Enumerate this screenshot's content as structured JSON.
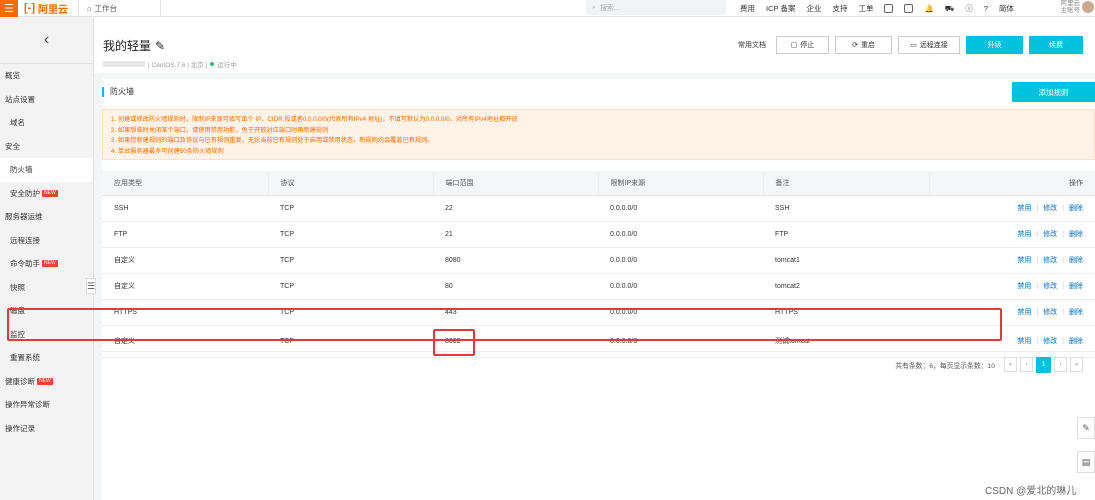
{
  "topbar": {
    "brand": "阿里云",
    "workbench": "工作台",
    "search_placeholder": "搜索...",
    "nav": [
      "费用",
      "ICP 备案",
      "企业",
      "支持",
      "工单",
      "简体"
    ],
    "account_name": "阿里云",
    "account_role": "主账号"
  },
  "sidebar": {
    "items": [
      {
        "label": "概览",
        "sub": false,
        "badge": ""
      },
      {
        "label": "站点设置",
        "sub": false,
        "badge": ""
      },
      {
        "label": "域名",
        "sub": true,
        "badge": ""
      },
      {
        "label": "安全",
        "sub": false,
        "badge": ""
      },
      {
        "label": "防火墙",
        "sub": true,
        "badge": "",
        "active": true
      },
      {
        "label": "安全防护",
        "sub": true,
        "badge": "NEW"
      },
      {
        "label": "服务器运维",
        "sub": false,
        "badge": ""
      },
      {
        "label": "远程连接",
        "sub": true,
        "badge": ""
      },
      {
        "label": "命令助手",
        "sub": true,
        "badge": "NEW"
      },
      {
        "label": "快照",
        "sub": true,
        "badge": ""
      },
      {
        "label": "磁盘",
        "sub": true,
        "badge": ""
      },
      {
        "label": "监控",
        "sub": true,
        "badge": ""
      },
      {
        "label": "重置系统",
        "sub": true,
        "badge": ""
      },
      {
        "label": "健康诊断",
        "sub": false,
        "badge": "NEW"
      },
      {
        "label": "操作异常诊断",
        "sub": false,
        "badge": ""
      },
      {
        "label": "操作记录",
        "sub": false,
        "badge": ""
      }
    ]
  },
  "header": {
    "title": "我的轻量",
    "meta_os": "| CentOS 7.6 | 北京 |",
    "meta_status": "运行中",
    "doc_link": "常用文档",
    "buttons": {
      "stop": "停止",
      "restart": "重启",
      "remote": "远程连接",
      "upgrade": "升级",
      "renew": "续费"
    }
  },
  "firewall": {
    "section_title": "防火墙",
    "add_rule": "添加规则",
    "tips": [
      "1. 创建或修改防火墙规则时，限制IP来源可填写单个 IP、CIDR 段或者0.0.0.0/0(代表所有IPv4 地址)，不填写默认为0.0.0.0/0，对所有IPv4地址都开放",
      "2. 如果想临时关闭某个端口，请使用禁用功能，免于开放对应端口时再新建规则",
      "3. 如果您新建规则的端口及协议与已有规则重复，无论当前已有规则处于启用或禁用状态，新规则均会覆盖已有规则。",
      "4. 单台服务器最多可创建50条防火墙规则"
    ],
    "columns": [
      "应用类型",
      "协议",
      "端口范围",
      "限制IP来源",
      "备注",
      "操作"
    ],
    "rows": [
      {
        "type": "SSH",
        "proto": "TCP",
        "port": "22",
        "source": "0.0.0.0/0",
        "note": "SSH"
      },
      {
        "type": "FTP",
        "proto": "TCP",
        "port": "21",
        "source": "0.0.0.0/0",
        "note": "FTP"
      },
      {
        "type": "自定义",
        "proto": "TCP",
        "port": "8080",
        "source": "0.0.0.0/0",
        "note": "tomcat1"
      },
      {
        "type": "自定义",
        "proto": "TCP",
        "port": "80",
        "source": "0.0.0.0/0",
        "note": "tomcat2"
      },
      {
        "type": "HTTPS",
        "proto": "TCP",
        "port": "443",
        "source": "0.0.0.0/0",
        "note": "HTTPS"
      },
      {
        "type": "自定义",
        "proto": "TCP",
        "port": "8082",
        "source": "0.0.0.0/0",
        "note": "测试tomcat"
      }
    ],
    "ops": {
      "disable": "禁用",
      "edit": "修改",
      "delete": "删除"
    },
    "pager": {
      "summary": "共有条数：6，每页显示条数：10",
      "first": "«",
      "prev": "‹",
      "page": "1",
      "next": "›",
      "last": "»"
    }
  },
  "watermark": "CSDN @爱北的琳儿"
}
